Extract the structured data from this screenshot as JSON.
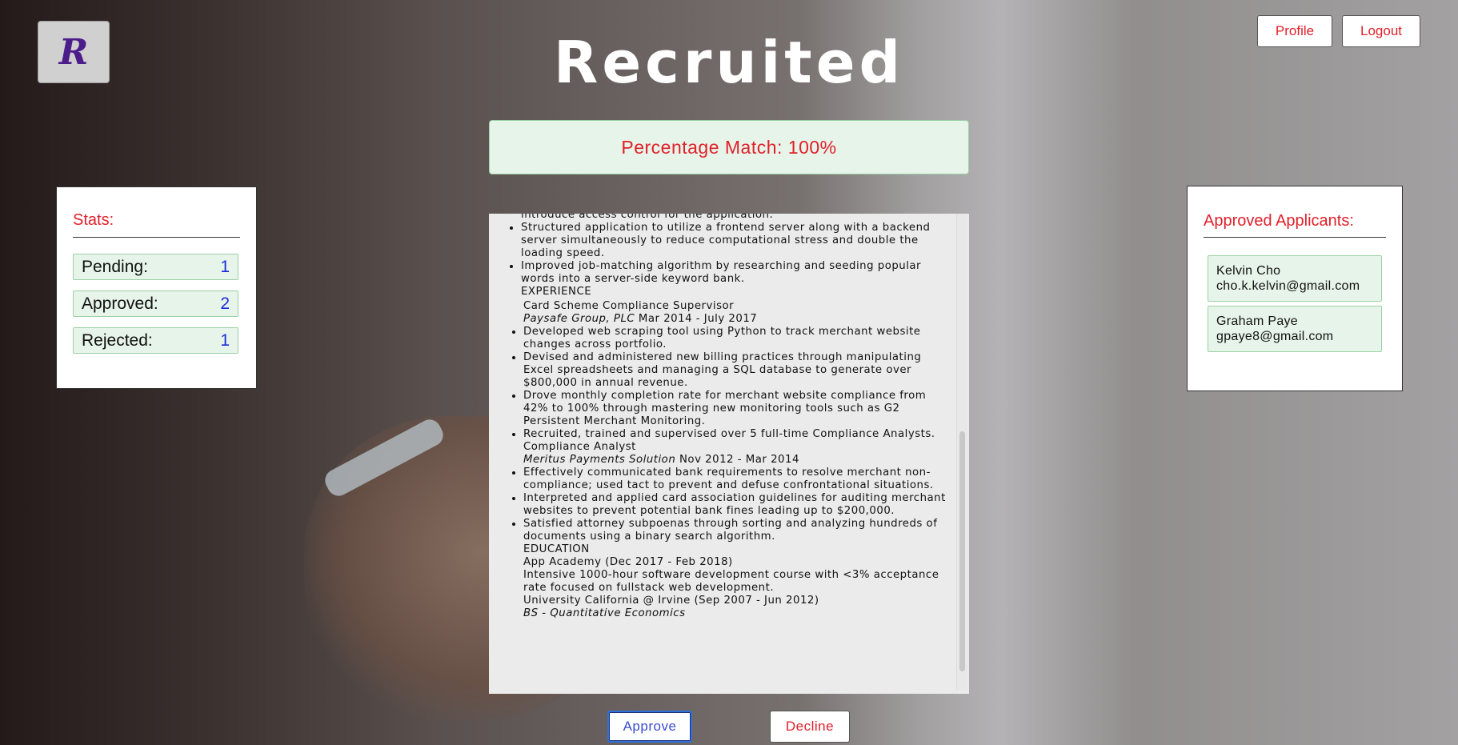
{
  "header": {
    "logo_letter": "R",
    "title": "Recruited",
    "profile_label": "Profile",
    "logout_label": "Logout"
  },
  "match": {
    "text": "Percentage Match: 100%"
  },
  "stats": {
    "title": "Stats:",
    "rows": [
      {
        "label": "Pending:",
        "value": "1"
      },
      {
        "label": "Approved:",
        "value": "2"
      },
      {
        "label": "Rejected:",
        "value": "1"
      }
    ]
  },
  "applicants": {
    "title": "Approved Applicants:",
    "items": [
      {
        "name": "Kelvin Cho",
        "email": "cho.k.kelvin@gmail.com"
      },
      {
        "name": "Graham Paye",
        "email": "gpaye8@gmail.com"
      }
    ]
  },
  "resume": {
    "top_fragment": "introduce access control for the application.",
    "project_bullets": [
      "Structured application to utilize a frontend server along with a backend server simultaneously to reduce computational stress and double the loading speed.",
      "Improved job-matching algorithm by researching and seeding popular words into a server-side keyword bank."
    ],
    "experience_heading": "EXPERIENCE",
    "job1": {
      "title": "Card Scheme Compliance Supervisor",
      "company": "Paysafe Group, PLC",
      "dates": "Mar 2014 - July 2017",
      "bullets": [
        "Developed web scraping tool using Python to track merchant website changes across portfolio.",
        "Devised and administered new billing practices through manipulating Excel spreadsheets and managing a SQL database to generate over $800,000 in annual revenue.",
        "Drove monthly completion rate for merchant website compliance from 42% to 100% through mastering new monitoring tools such as G2 Persistent Merchant Monitoring.",
        "Recruited, trained and supervised over 5 full-time Compliance Analysts."
      ]
    },
    "job2": {
      "title": "Compliance Analyst",
      "company": "Meritus Payments Solution",
      "dates": "Nov 2012 - Mar 2014",
      "bullets": [
        "Effectively communicated bank requirements to resolve merchant non-compliance; used tact to prevent and defuse confrontational situations.",
        "Interpreted and applied card association guidelines for auditing merchant websites to prevent potential bank fines leading up to $200,000.",
        "Satisfied attorney subpoenas through sorting and analyzing hundreds of documents using a binary search algorithm."
      ]
    },
    "education_heading": "EDUCATION",
    "edu1": "App Academy (Dec 2017 - Feb 2018)",
    "edu1_desc": "Intensive 1000-hour software development course with <3% acceptance rate focused on fullstack web development.",
    "edu2": "University California @ Irvine (Sep 2007 - Jun 2012)",
    "edu2_degree": "BS - Quantitative Economics"
  },
  "actions": {
    "approve_label": "Approve",
    "decline_label": "Decline"
  },
  "colors": {
    "accent_red": "#e0202a",
    "stat_number_blue": "#1a2bdc",
    "card_green_bg": "#e7f4e9",
    "logo_purple": "#4b1c8a"
  }
}
